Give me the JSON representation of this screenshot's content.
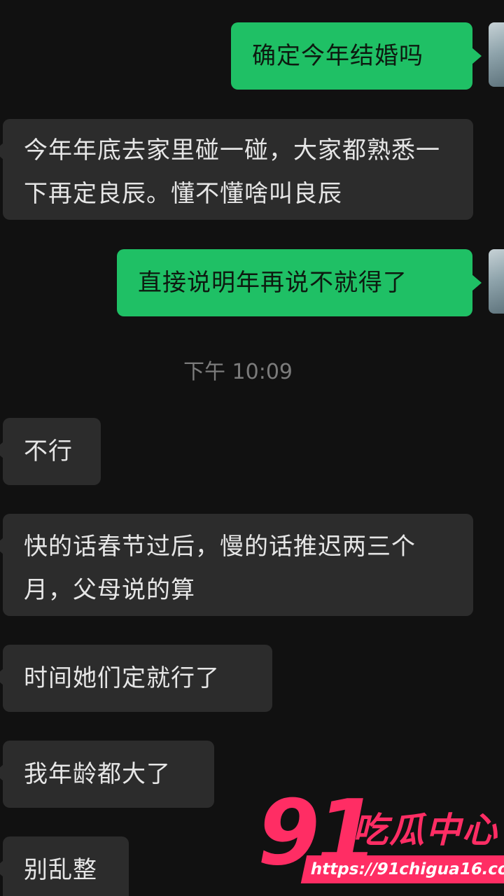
{
  "messages": [
    {
      "id": "m1",
      "sender": "me",
      "text": "确定今年结婚吗"
    },
    {
      "id": "m2",
      "sender": "other",
      "text": "今年年底去家里碰一碰，大家都熟悉一下再定良辰。懂不懂啥叫良辰"
    },
    {
      "id": "m3",
      "sender": "me",
      "text": "直接说明年再说不就得了"
    },
    {
      "id": "m4",
      "sender": "other",
      "text": "不行"
    },
    {
      "id": "m5",
      "sender": "other",
      "text": "快的话春节过后，慢的话推迟两三个月，父母说的算"
    },
    {
      "id": "m6",
      "sender": "other",
      "text": "时间她们定就行了"
    },
    {
      "id": "m7",
      "sender": "other",
      "text": "我年龄都大了"
    },
    {
      "id": "m8",
      "sender": "other",
      "text": "别乱整"
    }
  ],
  "timestamp": "下午 10:09",
  "watermark": {
    "number": "91",
    "brand": "吃瓜中心",
    "url": "https://91chigua16.com",
    "color": "#ff2d64"
  },
  "colors": {
    "background": "#111111",
    "outgoing_bubble": "#1fc065",
    "incoming_bubble": "#2c2c2c"
  }
}
